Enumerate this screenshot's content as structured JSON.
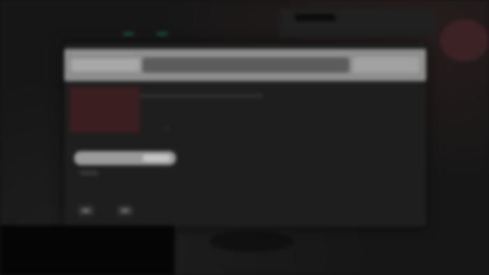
{
  "window": {
    "address_value": ""
  },
  "icons": {
    "back": "chevron-left-icon",
    "forward": "chevron-right-icon"
  },
  "colors": {
    "address_bar": "#8e8e8e",
    "side_panel": "#3b1e20",
    "accent": "#1b4a3b",
    "background": "#161616"
  }
}
